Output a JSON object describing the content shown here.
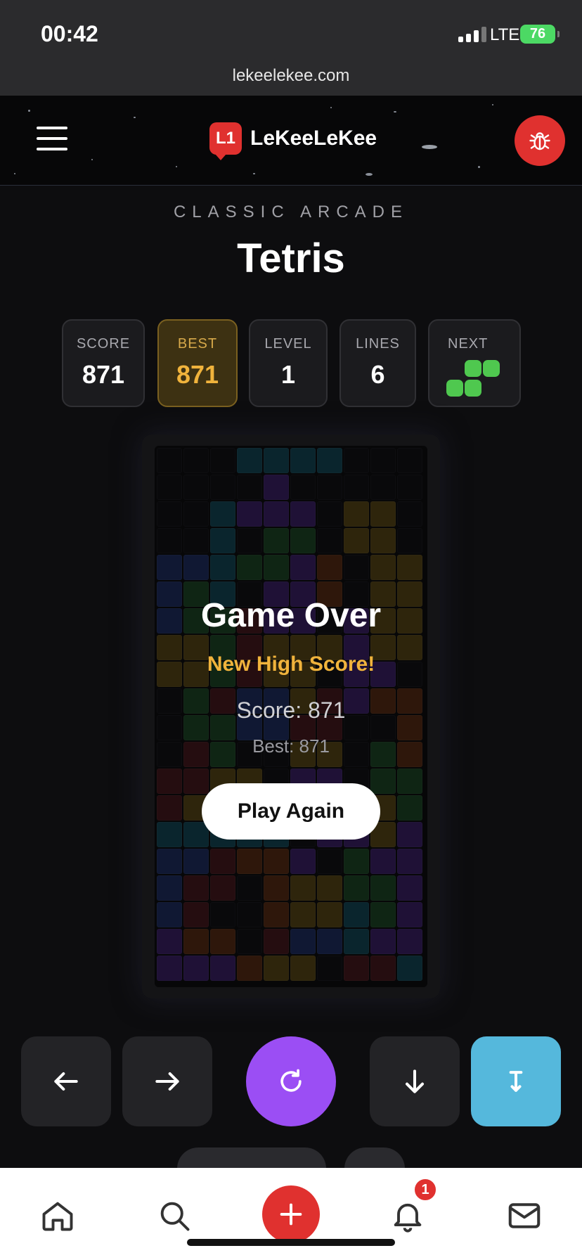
{
  "status_bar": {
    "time": "00:42",
    "network": "LTE",
    "battery": "76"
  },
  "browser": {
    "url": "lekeelekee.com"
  },
  "site_header": {
    "logo_mark": "L1",
    "logo_text": "LeKeeLeKee",
    "icons": [
      "menu-icon",
      "bug-icon"
    ]
  },
  "page": {
    "eyebrow": "CLASSIC ARCADE",
    "title": "Tetris"
  },
  "stats": {
    "score_label": "SCORE",
    "score_value": "871",
    "best_label": "BEST",
    "best_value": "871",
    "level_label": "LEVEL",
    "level_value": "1",
    "lines_label": "LINES",
    "lines_value": "6",
    "next_label": "NEXT",
    "next_piece": "S",
    "next_color": "#4fc84f"
  },
  "board": {
    "columns": 10,
    "rows": 20,
    "legend": {
      ".": "empty",
      "C": "#0f4a5a",
      "P": "#3c1d6e",
      "Y": "#5e4a10",
      "G": "#1a4a22",
      "B": "#1b2e66",
      "O": "#5e2c0e",
      "R": "#4a1619"
    },
    "grid": [
      "...CCCC...",
      "....P.....",
      "..CPPP.YY.",
      "..C.GG.YY.",
      "BBCGGPO.YY",
      "BGC.PPO.YY",
      "BGGRPP.PYY",
      "YYGRYYYPYY",
      "YYGRYY.PP.",
      ".GRBBYRPOO",
      ".GGBBRR..O",
      ".RG..YY.GO",
      "RRYY.PP.GG",
      "RYYY.YYYYG",
      "CCCCC.PPYP",
      "BBROOP.GPP",
      "BRR.OYYGGP",
      "BR..OYYCGP",
      "POO.RBBCPP",
      "PPPOYY.RRC"
    ]
  },
  "game_over": {
    "title": "Game Over",
    "subtitle": "New High Score!",
    "score_text": "Score: 871",
    "best_text": "Best: 871",
    "button_label": "Play Again"
  },
  "controls": {
    "icons": [
      "arrow-left-icon",
      "arrow-right-icon",
      "rotate-icon",
      "arrow-down-icon",
      "hard-drop-icon"
    ],
    "rotate_color": "#9b4ef4",
    "drop_color": "#55b8dc"
  },
  "bottom_nav": {
    "icons": [
      "home-icon",
      "search-icon",
      "plus-icon",
      "bell-icon",
      "mail-icon"
    ],
    "notification_count": "1",
    "accent": "#e0312f"
  }
}
